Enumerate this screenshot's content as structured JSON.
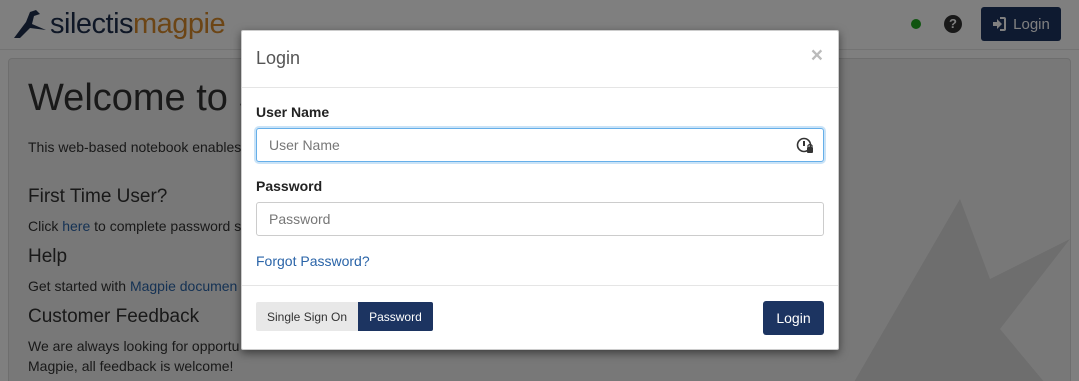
{
  "navbar": {
    "logo_part1": "silectis",
    "logo_part2": "magpie",
    "status": "online",
    "help_icon": "question-circle-icon",
    "login_label": "Login",
    "login_icon": "sign-in-icon"
  },
  "background": {
    "title": "Welcome to S",
    "intro": "This web-based notebook enables",
    "first_time_heading": "First Time User?",
    "first_time_pre": "Click ",
    "first_time_link": "here",
    "first_time_post": " to complete password s",
    "help_heading": "Help",
    "help_pre": "Get started with ",
    "help_link": "Magpie documen",
    "feedback_heading": "Customer Feedback",
    "feedback_line1": "We are always looking for opportu",
    "feedback_line2": "Magpie, all feedback is welcome!"
  },
  "modal": {
    "title": "Login",
    "close_symbol": "×",
    "username_label": "User Name",
    "username_placeholder": "User Name",
    "username_value": "",
    "password_label": "Password",
    "password_placeholder": "Password",
    "password_value": "",
    "forgot_link": "Forgot Password?",
    "auth_modes": [
      {
        "label": "Single Sign On",
        "selected": false
      },
      {
        "label": "Password",
        "selected": true
      }
    ],
    "submit_label": "Login"
  },
  "colors": {
    "brand_navy": "#1c3461",
    "brand_orange": "#d98a2b",
    "link_blue": "#2a64a8",
    "status_green": "#1ea81e"
  }
}
